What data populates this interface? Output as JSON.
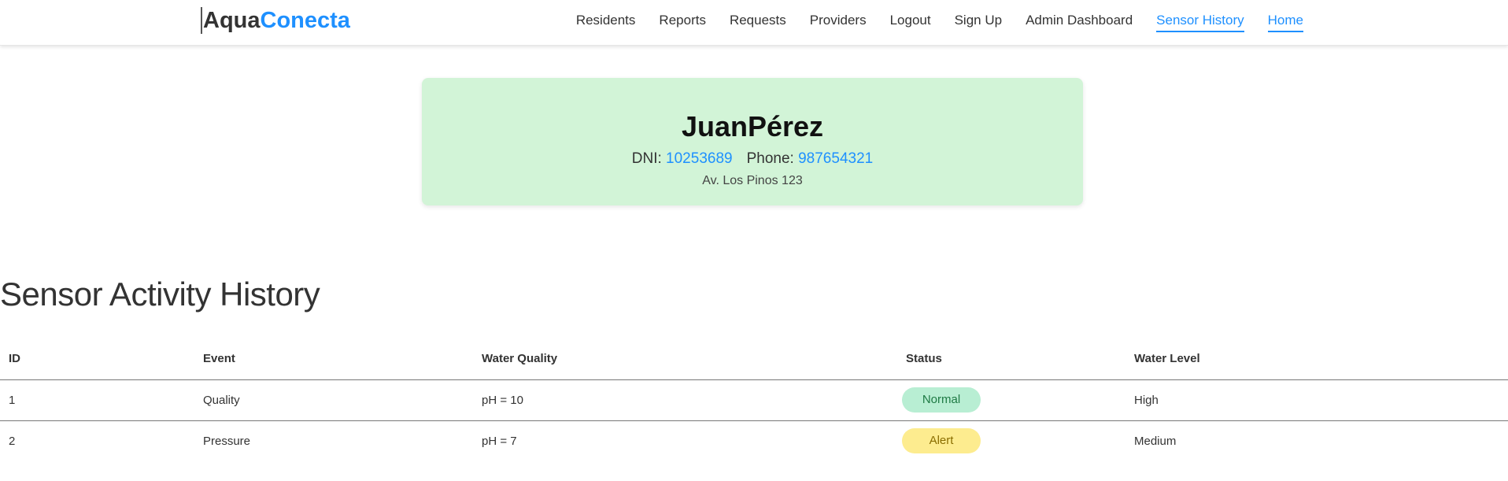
{
  "brand": {
    "part1": "Aqua",
    "part2": "Conecta"
  },
  "nav": [
    {
      "label": "Residents",
      "active": false
    },
    {
      "label": "Reports",
      "active": false
    },
    {
      "label": "Requests",
      "active": false
    },
    {
      "label": "Providers",
      "active": false
    },
    {
      "label": "Logout",
      "active": false
    },
    {
      "label": "Sign Up",
      "active": false
    },
    {
      "label": "Admin Dashboard",
      "active": false
    },
    {
      "label": "Sensor History",
      "active": true
    },
    {
      "label": "Home",
      "active": true
    }
  ],
  "profile": {
    "name": "JuanPérez",
    "dni_label": "DNI:",
    "dni": "10253689",
    "phone_label": "Phone:",
    "phone": "987654321",
    "address": "Av. Los Pinos 123"
  },
  "section_title": "Sensor Activity History",
  "table": {
    "headers": [
      "ID",
      "Event",
      "Water Quality",
      "Status",
      "Water Level"
    ],
    "rows": [
      {
        "id": "1",
        "event": "Quality",
        "quality": "pH = 10",
        "status": "Normal",
        "status_type": "normal",
        "level": "High"
      },
      {
        "id": "2",
        "event": "Pressure",
        "quality": "pH = 7",
        "status": "Alert",
        "status_type": "alert",
        "level": "Medium"
      }
    ]
  },
  "colors": {
    "accent": "#1e90ff",
    "card_bg": "#d2f4d7",
    "status_normal_bg": "#b8eed3",
    "status_alert_bg": "#fdec8f"
  }
}
